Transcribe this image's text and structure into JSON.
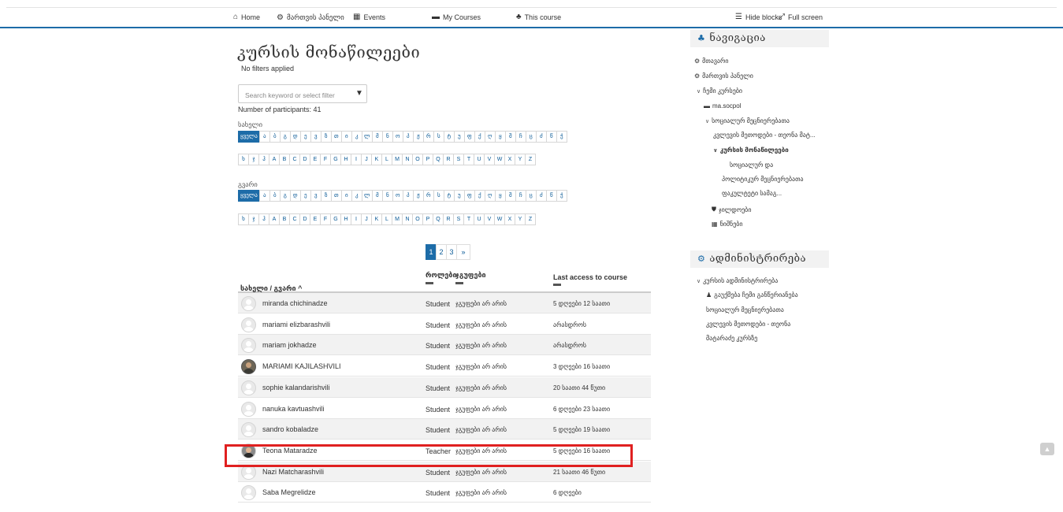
{
  "topnav": {
    "home": "Home",
    "dashboard": "მართვის პანელი",
    "events": "Events",
    "my_courses": "My Courses",
    "this_course": "This course",
    "hide_blocks": "Hide blocks",
    "full_screen": "Full screen"
  },
  "page": {
    "title": "კურსის მონაწილეები",
    "no_filters": "No filters applied",
    "search_placeholder": "Search keyword or select filter",
    "participants_count": "Number of participants: 41",
    "firstname_label": "სახელი",
    "lastname_label": "გვარი",
    "all_label": "ყველა",
    "letters_row1": [
      "ა",
      "ბ",
      "გ",
      "დ",
      "ე",
      "ვ",
      "ზ",
      "თ",
      "ი",
      "კ",
      "ლ",
      "მ",
      "ნ",
      "ო",
      "პ",
      "ჟ",
      "რ",
      "ს",
      "ტ",
      "უ",
      "ფ",
      "ქ",
      "ღ",
      "ყ",
      "შ",
      "ჩ",
      "ც",
      "ძ",
      "წ",
      "ჭ"
    ],
    "letters_row2": [
      "ხ",
      "ჯ",
      "ჰ",
      "A",
      "B",
      "C",
      "D",
      "E",
      "F",
      "G",
      "H",
      "I",
      "J",
      "K",
      "L",
      "M",
      "N",
      "O",
      "P",
      "Q",
      "R",
      "S",
      "T",
      "U",
      "V",
      "W",
      "X",
      "Y",
      "Z"
    ]
  },
  "pager": {
    "pages": [
      "1",
      "2",
      "3",
      "»"
    ],
    "active": "1"
  },
  "table": {
    "headers": {
      "name": "სახელი / გვარი",
      "sort_indicator": "^",
      "roles": "როლები",
      "groups": "ჯგუფები",
      "last_access": "Last access to course"
    },
    "rows": [
      {
        "name": "miranda chichinadze",
        "role": "Student",
        "group": "ჯგუფები არ არის",
        "last": "5 დღეები 12 საათი",
        "avatar": "default"
      },
      {
        "name": "mariami elizbarashvili",
        "role": "Student",
        "group": "ჯგუფები არ არის",
        "last": "არასდროს",
        "avatar": "default"
      },
      {
        "name": "mariam jokhadze",
        "role": "Student",
        "group": "ჯგუფები არ არის",
        "last": "არასდროს",
        "avatar": "default"
      },
      {
        "name": "MARIAMI KAJILASHVILI",
        "role": "Student",
        "group": "ჯგუფები არ არის",
        "last": "3 დღეები 16 საათი",
        "avatar": "photo"
      },
      {
        "name": "sophie kalandarishvili",
        "role": "Student",
        "group": "ჯგუფები არ არის",
        "last": "20 საათი 44 წუთი",
        "avatar": "default"
      },
      {
        "name": "nanuka kavtuashvili",
        "role": "Student",
        "group": "ჯგუფები არ არის",
        "last": "6 დღეები 23 საათი",
        "avatar": "default"
      },
      {
        "name": "sandro kobaladze",
        "role": "Student",
        "group": "ჯგუფები არ არის",
        "last": "5 დღეები 19 საათი",
        "avatar": "default"
      },
      {
        "name": "Teona Mataradze",
        "role": "Teacher",
        "group": "ჯგუფები არ არის",
        "last": "5 დღეები 16 საათი",
        "avatar": "photo2"
      },
      {
        "name": "Nazi Matcharashvili",
        "role": "Student",
        "group": "ჯგუფები არ არის",
        "last": "21 საათი 46 წუთი",
        "avatar": "default"
      },
      {
        "name": "Saba Megrelidze",
        "role": "Student",
        "group": "ჯგუფები არ არის",
        "last": "6 დღეები",
        "avatar": "default"
      }
    ]
  },
  "sidebar": {
    "nav_title": "ნავიგაცია",
    "nav": {
      "home": "მთავარი",
      "dashboard": "მართვის პანელი",
      "my_courses": "ჩემი კურსები",
      "course": "ma.socpol",
      "section_1": "სოციალურ მეცნიერებათა",
      "section_2": "კვლევის მეთოდები - თეონა მატ...",
      "participants": "კურსის მონაწილეები",
      "faculty_1": "სოციალურ და",
      "faculty_2": "პოლიტიკურ მეცნიერებათა",
      "faculty_3": "ფაკულტეტი სამაგ...",
      "badges": "ჯილდოები",
      "grades": "ნიშნები"
    },
    "admin_title": "ადმინისტრირება",
    "admin": {
      "course_admin": "კურსის ადმინისტრირება",
      "unenrol_1": "გაუქმება ჩემი განწერიანება",
      "unenrol_2": "სოციალურ მეცნიერებათა",
      "unenrol_3": "კვლევის მეთოდები - თეონა",
      "unenrol_4": "მატარაძე კურსზე"
    }
  },
  "colors": {
    "accent": "#1d6ca8",
    "highlight": "#e02020"
  }
}
